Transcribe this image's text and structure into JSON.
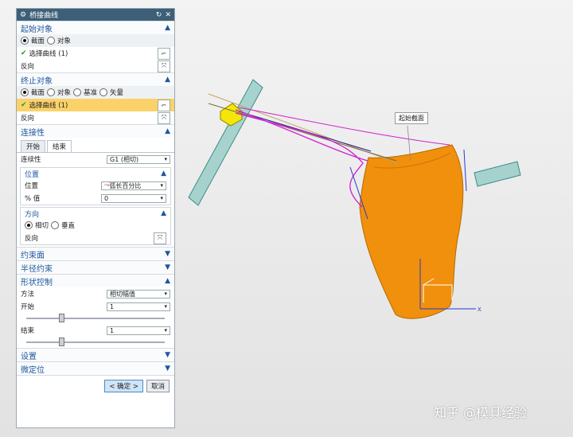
{
  "dialog": {
    "title": "桥接曲线",
    "start": {
      "header": "起始对象",
      "options": [
        "截面",
        "对象"
      ],
      "selected": 0,
      "select_label": "选择曲线 (1)",
      "reverse_label": "反向"
    },
    "end": {
      "header": "终止对象",
      "options": [
        "截面",
        "对象",
        "基准",
        "矢量"
      ],
      "selected": 0,
      "select_label": "选择曲线 (1)",
      "reverse_label": "反向"
    },
    "continuity": {
      "header": "连接性",
      "tabs": [
        "开始",
        "结束"
      ],
      "active_tab": 1,
      "continuity_label": "连续性",
      "continuity_value": "G1 (相切)",
      "position": {
        "header": "位置",
        "position_label": "位置",
        "position_value": "弧长百分比",
        "percent_label": "% 值",
        "percent_value": "0"
      },
      "direction": {
        "header": "方向",
        "options": [
          "相切",
          "垂直"
        ],
        "selected": 0,
        "reverse_label": "反向"
      }
    },
    "collapsed_sections": [
      "约束面",
      "半径约束"
    ],
    "shape": {
      "header": "形状控制",
      "method_label": "方法",
      "method_value": "相切幅值",
      "start_label": "开始",
      "start_value": "1",
      "start_slider": 0.25,
      "end_label": "结束",
      "end_value": "1",
      "end_slider": 0.25
    },
    "settings_header": "设置",
    "finetune_header": "微定位",
    "ok_label": "< 确定 >",
    "cancel_label": "取消"
  },
  "viewport": {
    "start_section_label": "起始截面",
    "axis_x": "X"
  },
  "watermark": "知乎 @模具经验"
}
